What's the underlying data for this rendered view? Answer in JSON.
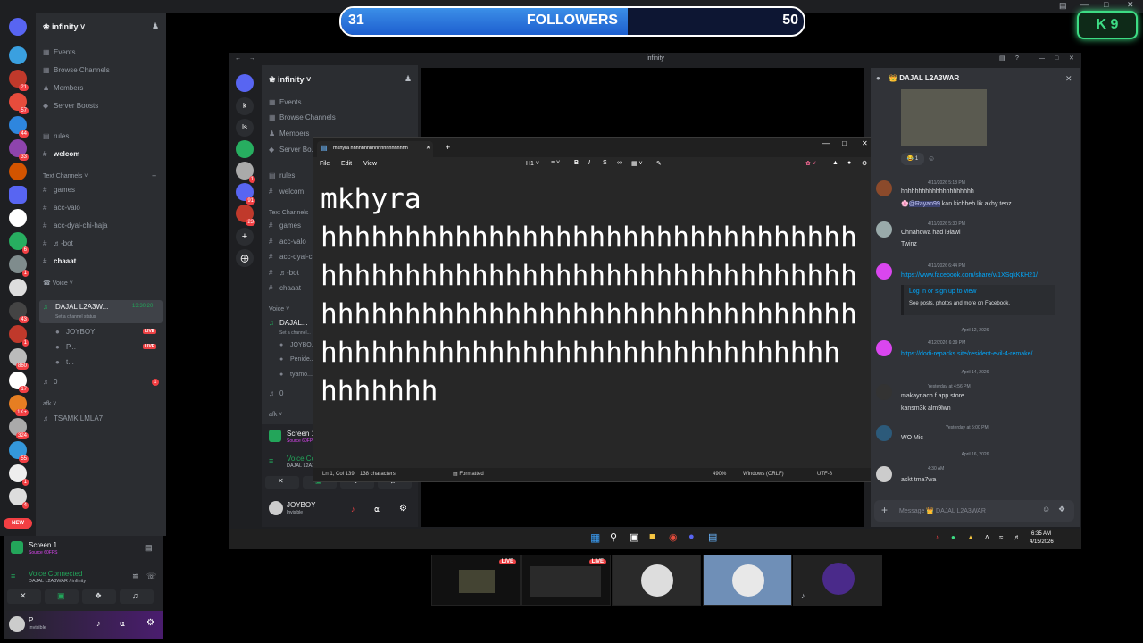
{
  "overlay": {
    "followers_label": "FOLLOWERS",
    "current": "31",
    "goal": "50",
    "progress_fraction": 0.62,
    "badge_text": "K 9"
  },
  "outer_discord": {
    "server_name": "infinity",
    "server_menu": [
      "Events",
      "Browse Channels",
      "Members",
      "Server Boosts"
    ],
    "channels_top": [
      "rules",
      "welcom"
    ],
    "text_category": "Text Channels",
    "text_channels": [
      "games",
      "acc-valo",
      "acc-dyal-chi-haja",
      "♬-bot",
      "chaaat"
    ],
    "voice_category": "Voice",
    "voice_channel": "DAJAL L2A3W...",
    "voice_timer": "13:30:20",
    "voice_status": "Set a channel status",
    "voice_users": [
      "JOYBOY",
      "P...",
      "t..."
    ],
    "live_label": "LIVE",
    "zero_channel": "0",
    "zero_badge": "1",
    "afk_category": "afk",
    "afk_channel": "TSAMK LMLA7",
    "server_badges": [
      "21",
      "57",
      "44",
      "33",
      "",
      "",
      "6",
      "1",
      "",
      "43",
      "1",
      "860",
      "17",
      "1K+",
      "324",
      "55",
      "1",
      "4"
    ],
    "new_label": "NEW",
    "screen_title": "Screen 1",
    "screen_sub": "Source 60FPS",
    "voice_connected": "Voice Connected",
    "voice_connected_sub": "DAJAL L2A3WAR / infinity",
    "user_name": "P...",
    "user_status": "Invisible"
  },
  "inner_window": {
    "title": "infinity",
    "server_name": "infinity",
    "server_menu": [
      "Events",
      "Browse Channels",
      "Members",
      "Server Bo..."
    ],
    "channels_top": [
      "rules",
      "welcom"
    ],
    "text_category": "Text Channels",
    "text_channels": [
      "games",
      "acc-valo",
      "acc-dyal-c...",
      "♬-bot",
      "chaaat"
    ],
    "voice_category": "Voice",
    "voice_channel": "DAJAL...",
    "voice_status": "Set a channel...",
    "voice_users": [
      "JOYBO...",
      "Penide...",
      "tyamo..."
    ],
    "zero_channel": "0",
    "afk_category": "afk",
    "server_labels": [
      "k",
      "ls"
    ],
    "server_badges": [
      "1",
      "91",
      "23"
    ],
    "screen_title": "Screen 1",
    "screen_sub": "Source 60FPS",
    "voice_connected": "Voice Connected",
    "voice_connected_sub": "DAJAL L2A3WAR / i...",
    "user_name": "JOYBOY",
    "user_status": "Invisible"
  },
  "notepad": {
    "tab_title": "mkhyra hhhhhhhhhhhhhhhhhhhhh",
    "menu": [
      "File",
      "Edit",
      "View"
    ],
    "heading": "H1",
    "content": "mkhyra\nhhhhhhhhhhhhhhhhhhhhhhhhhhhhhhhhhhhhhhhhhhhhhhhhhhhhhhhhhhhhhhhhhhhhhhhhhhhhhhhhhhhhhhhhhhhhhhhhhhhhhhhhhhhhhhhhhhhhhhhhhhhhhhh\nhhhhhhh",
    "line_col": "Ln 1, Col 139",
    "char_count": "138 characters",
    "formatted": "Formatted",
    "zoom": "490%",
    "line_ending": "Windows (CRLF)",
    "encoding": "UTF-8"
  },
  "chat": {
    "channel_title": "DAJAL L2A3WAR",
    "reaction_count": "1",
    "messages": [
      {
        "time": "4/11/2026 5:18 PM",
        "lines": [
          "hhhhhhhhhhhhhhhhhhhhh",
          "@Rayan99 kan kichbeh lik akhy tenz"
        ]
      },
      {
        "time": "4/11/2026 5:30 PM",
        "lines": [
          "Chnahowa had l9lawi",
          "Twinz"
        ]
      },
      {
        "time": "4/11/2026 6:44 PM",
        "lines": [
          "https://www.facebook.com/share/v/1XSqkKKH21/"
        ],
        "embed_title": "Log in or sign up to view",
        "embed_desc": "See posts, photos and more on Facebook."
      },
      {
        "time": "4/12/2026 6:39 PM",
        "lines": [
          "https://dodi-repacks.site/resident-evil-4-remake/"
        ]
      },
      {
        "time": "Yesterday at 4:56 PM",
        "lines": [
          "makaynach f app store",
          "kansm3k alm9lwn"
        ]
      },
      {
        "time": "Yesterday at 5:00 PM",
        "lines": [
          "WO Mic"
        ]
      },
      {
        "time": "4:30 AM",
        "lines": [
          "askt tma7wa"
        ]
      }
    ],
    "dividers": [
      "April 12, 2026",
      "April 14, 2026",
      "April 16, 2026"
    ],
    "input_placeholder": "Message 👑 DAJAL L2A3WAR"
  },
  "taskbar": {
    "time": "6:35 AM",
    "date": "4/15/2026"
  },
  "thumbnails": {
    "live_label": "LIVE"
  }
}
